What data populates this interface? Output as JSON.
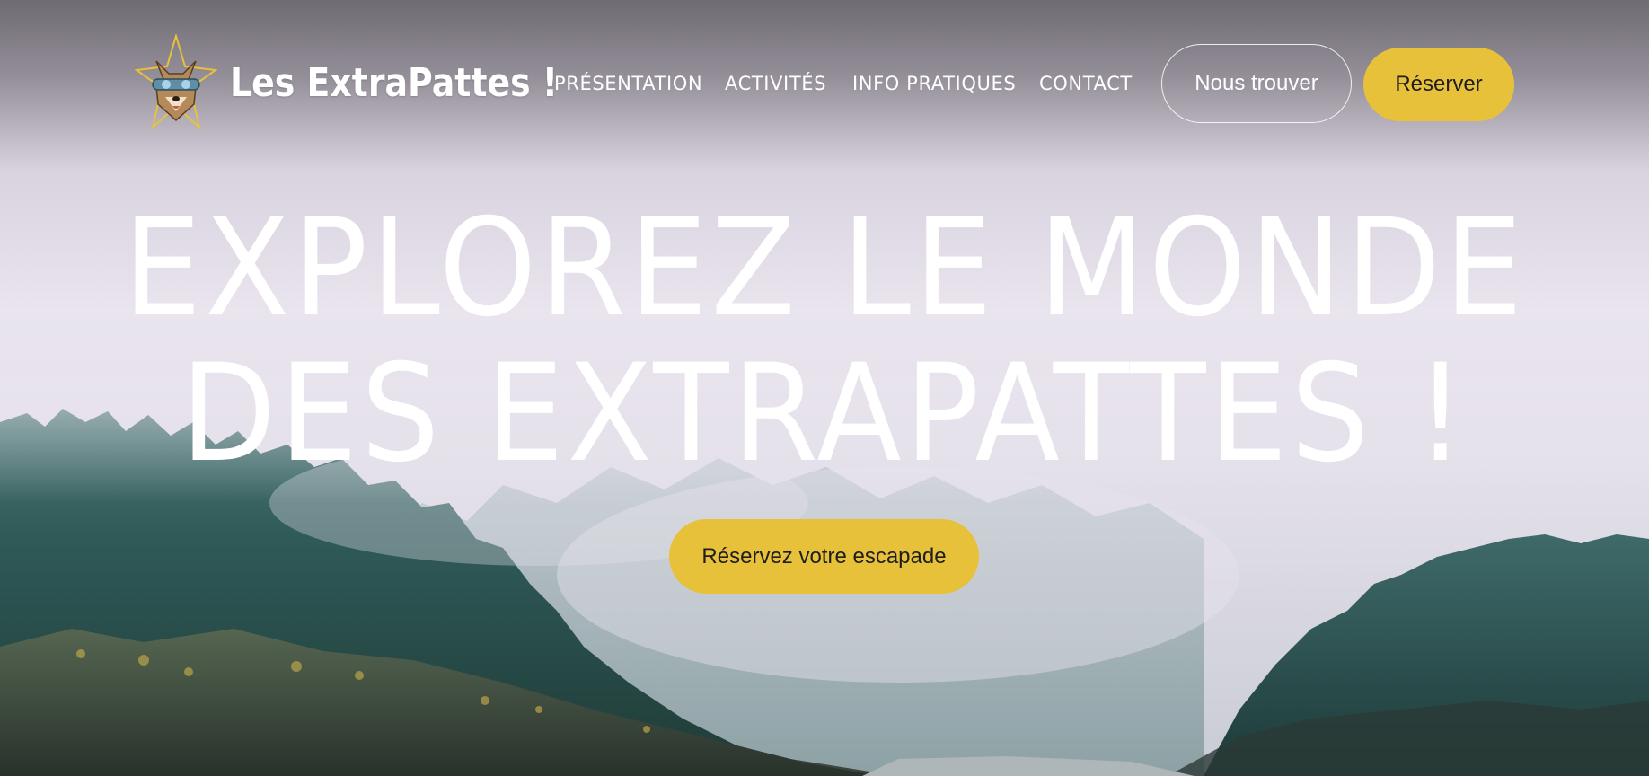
{
  "brand": {
    "name": "Les ExtraPattes !",
    "logo_icon": "wolf-with-goggles-icon",
    "accent_color": "#e8c13b"
  },
  "nav": {
    "items": [
      {
        "label": "PRÉSENTATION"
      },
      {
        "label": "ACTIVITÉS"
      },
      {
        "label": "INFO PRATIQUES"
      },
      {
        "label": "CONTACT"
      }
    ],
    "find_us_label": "Nous trouver",
    "book_label": "Réserver"
  },
  "hero": {
    "headline_line1": "EXPLOREZ LE MONDE",
    "headline_line2": "DES EXTRAPATTES !",
    "cta_label": "Réservez votre escapade",
    "background": "misty-forest-lake-image"
  }
}
